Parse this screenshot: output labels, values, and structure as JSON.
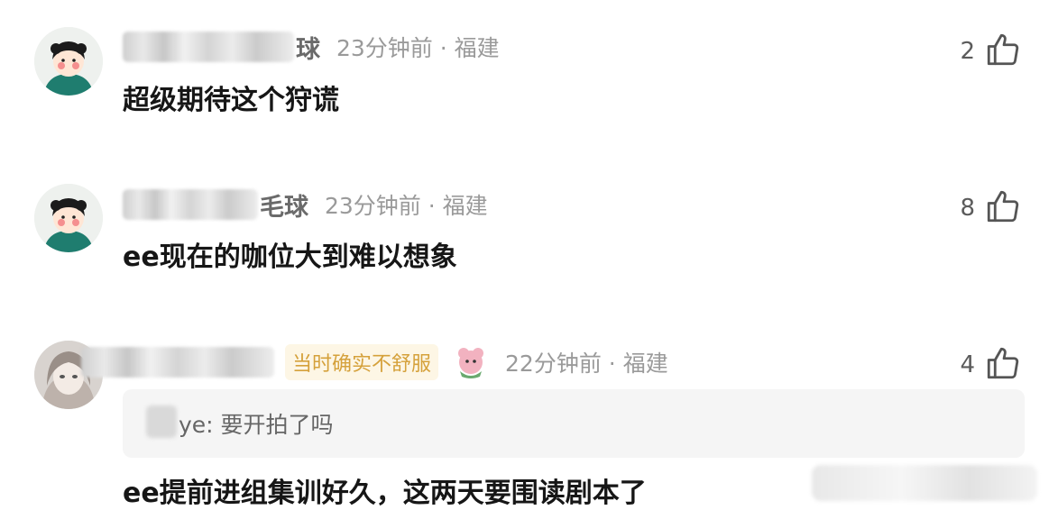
{
  "comments": [
    {
      "name_visible": "球",
      "time": "23分钟前",
      "separator": "·",
      "location": "福建",
      "text": "超级期待这个狩谎",
      "likes": "2"
    },
    {
      "name_visible": "毛球",
      "time": "23分钟前",
      "separator": "·",
      "location": "福建",
      "text": "ee现在的咖位大到难以想象",
      "likes": "8"
    },
    {
      "name_visible": "",
      "tag": "当时确实不舒服",
      "time": "22分钟前",
      "separator": "·",
      "location": "福建",
      "reply": "ye: 要开拍了吗",
      "text": "ee提前进组集训好久，这两天要围读剧本了",
      "likes": "4"
    }
  ],
  "colors": {
    "meta_gray": "#9a9a9a",
    "tag_text": "#d5a13b",
    "tag_bg": "#fdf6e5",
    "reply_bg": "#f5f5f5"
  },
  "icons": [
    "thumbs-up-icon",
    "avatar-cartoon-girl",
    "avatar-anime-girl",
    "sticker-icon"
  ]
}
